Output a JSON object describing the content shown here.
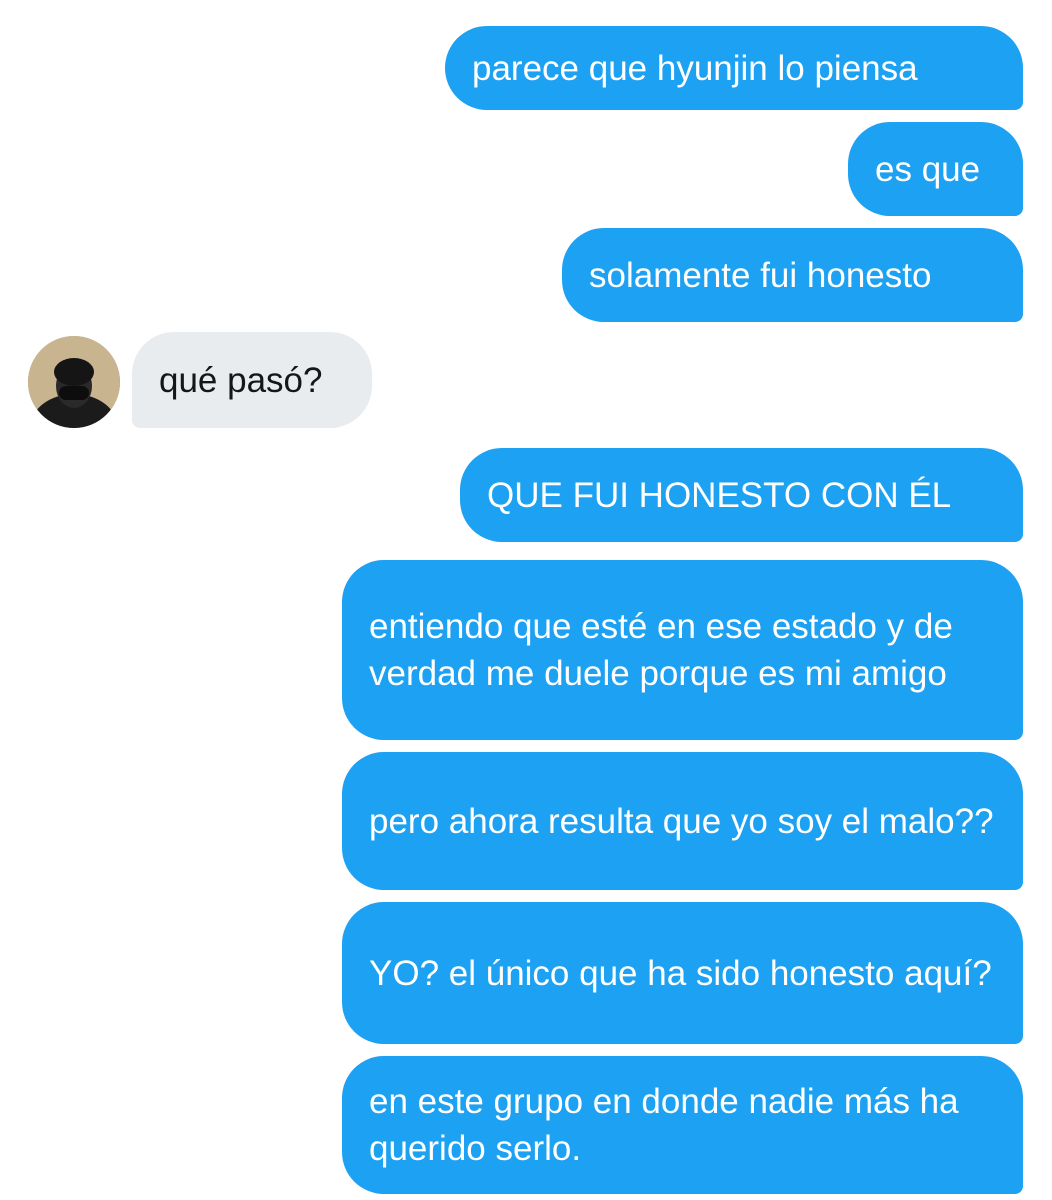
{
  "conversation": {
    "messages": [
      {
        "sender": "me",
        "text": "parece que hyunjin lo piensa"
      },
      {
        "sender": "me",
        "text": "es que"
      },
      {
        "sender": "me",
        "text": "solamente fui honesto"
      },
      {
        "sender": "them",
        "text": "qué pasó?"
      },
      {
        "sender": "me",
        "text": "QUE FUI HONESTO CON ÉL"
      },
      {
        "sender": "me",
        "text": "entiendo que esté en ese estado y de verdad me duele porque es mi amigo"
      },
      {
        "sender": "me",
        "text": "pero ahora resulta que yo soy el malo??"
      },
      {
        "sender": "me",
        "text": "YO? el único que ha sido honesto aquí?"
      },
      {
        "sender": "me",
        "text": "en este grupo en donde nadie más ha querido serlo."
      }
    ]
  },
  "colors": {
    "outgoing_bubble": "#1da1f2",
    "incoming_bubble": "#e8ecef",
    "outgoing_text": "#ffffff",
    "incoming_text": "#14171a"
  },
  "icons": {
    "avatar": "user-avatar"
  }
}
